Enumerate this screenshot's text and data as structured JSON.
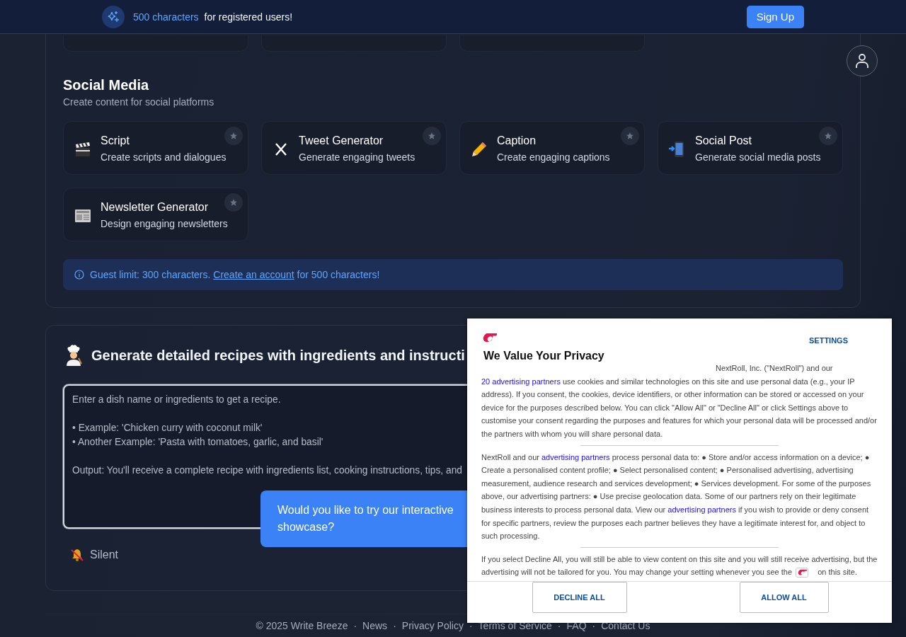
{
  "banner": {
    "highlight": "500 characters",
    "text": "for registered users!",
    "button": "Sign Up"
  },
  "social_media": {
    "title": "Social Media",
    "subtitle": "Create content for social platforms",
    "tools": [
      {
        "title": "Script",
        "description": "Create scripts and dialogues"
      },
      {
        "title": "Tweet Generator",
        "description": "Generate engaging tweets"
      },
      {
        "title": "Caption",
        "description": "Create engaging captions"
      },
      {
        "title": "Social Post",
        "description": "Generate social media posts"
      },
      {
        "title": "Newsletter Generator",
        "description": "Design engaging newsletters"
      }
    ],
    "notice": [
      {
        "kind": "text",
        "text": "Guest limit: 300 characters. "
      },
      {
        "kind": "link",
        "text": "Create an account"
      },
      {
        "kind": "text",
        "text": " for 500 characters!"
      }
    ]
  },
  "recipe": {
    "title": "Generate detailed recipes with ingredients and instructi",
    "placeholder": "Enter a dish name or ingredients to get a recipe.\n\n• Example: 'Chicken curry with coconut milk'\n• Another Example: 'Pasta with tomatoes, garlic, and basil'\n\nOutput: You'll receive a complete recipe with ingredients list, cooking instructions, tips, and",
    "sound_toggle": "Silent"
  },
  "showcase_tip": "Would you like to try our interactive showcase?",
  "footer": {
    "items": [
      "© 2025 Write Breeze",
      "News",
      "Privacy Policy",
      "Terms of Service",
      "FAQ",
      "Contact Us"
    ],
    "separators": [
      "·",
      "·",
      "·",
      "·",
      "·"
    ]
  },
  "consent": {
    "settings": "SETTINGS",
    "title": "We Value Your Privacy",
    "paragraphs": [
      [
        {
          "kind": "text",
          "text": "NextRoll, Inc. (\"NextRoll\") and our "
        },
        {
          "kind": "link",
          "text": "20 advertising partners"
        },
        {
          "kind": "text",
          "text": " use cookies and similar technologies on this site and use personal data (e.g., your IP address). If you consent, the cookies, device identifiers, or other information can be stored or accessed on your device for the purposes described below. You can click \"Allow All\" or \"Decline All\" or click Settings above to customise your consent regarding the purposes and features for which your personal data will be processed and/or the partners with whom you will share personal data."
        }
      ],
      [
        {
          "kind": "text",
          "text": "NextRoll and our "
        },
        {
          "kind": "link",
          "text": "advertising partners"
        },
        {
          "kind": "text",
          "text": " process personal data to: ● Store and/or access information on a device; ● Create a personalised content profile; ● Select personalised content; ● Personalised advertising, advertising measurement, audience research and services development; ● Services development. For some of the purposes above, our advertising partners: ● Use precise geolocation data. Some of our partners rely on their legitimate business interests to process personal data. View our "
        },
        {
          "kind": "link",
          "text": "advertising partners"
        },
        {
          "kind": "text",
          "text": " if you wish to provide or deny consent for specific partners, review the purposes each partner believes they have a legitimate interest for, and object to such processing."
        }
      ],
      [
        {
          "kind": "text",
          "text": "If you select Decline All, you will still be able to view content on this site and you will still receive advertising, but the advertising will not be tailored for you. You may change your setting whenever you see the "
        },
        {
          "kind": "logo"
        },
        {
          "kind": "text",
          "text": " on this site."
        }
      ]
    ],
    "buttons": [
      "DECLINE ALL",
      "ALLOW ALL"
    ]
  }
}
